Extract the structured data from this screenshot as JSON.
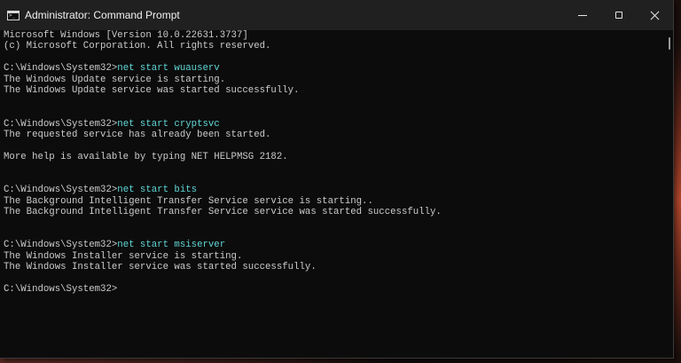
{
  "window": {
    "title": "Administrator: Command Prompt"
  },
  "icons": {
    "app": "command-prompt-icon",
    "minimize": "minimize-icon",
    "maximize": "maximize-icon",
    "close": "close-icon"
  },
  "console": {
    "lines": [
      {
        "text": "Microsoft Windows [Version 10.0.22631.3737]"
      },
      {
        "text": "(c) Microsoft Corporation. All rights reserved."
      },
      {
        "text": ""
      },
      {
        "prompt": "C:\\Windows\\System32>",
        "cmd": "net start wuauserv"
      },
      {
        "text": "The Windows Update service is starting."
      },
      {
        "text": "The Windows Update service was started successfully."
      },
      {
        "text": ""
      },
      {
        "text": ""
      },
      {
        "prompt": "C:\\Windows\\System32>",
        "cmd": "net start cryptsvc"
      },
      {
        "text": "The requested service has already been started."
      },
      {
        "text": ""
      },
      {
        "text": "More help is available by typing NET HELPMSG 2182."
      },
      {
        "text": ""
      },
      {
        "text": ""
      },
      {
        "prompt": "C:\\Windows\\System32>",
        "cmd": "net start bits"
      },
      {
        "text": "The Background Intelligent Transfer Service service is starting.."
      },
      {
        "text": "The Background Intelligent Transfer Service service was started successfully."
      },
      {
        "text": ""
      },
      {
        "text": ""
      },
      {
        "prompt": "C:\\Windows\\System32>",
        "cmd": "net start msiserver"
      },
      {
        "text": "The Windows Installer service is starting."
      },
      {
        "text": "The Windows Installer service was started successfully."
      },
      {
        "text": ""
      },
      {
        "prompt": "C:\\Windows\\System32>",
        "cmd": ""
      }
    ]
  },
  "colors": {
    "console_bg": "#0c0c0c",
    "console_text": "#cccccc",
    "command_text": "#61d6d6",
    "titlebar_bg": "#202020"
  }
}
